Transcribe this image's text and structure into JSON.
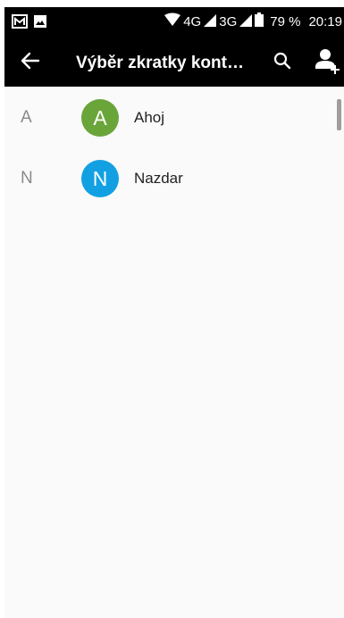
{
  "status_bar": {
    "left_icons": [
      "gallery-icon",
      "image-icon"
    ],
    "network1": "4G",
    "network2": "3G",
    "battery": "79 %",
    "time": "20:19"
  },
  "app_bar": {
    "title": "Výběr zkratky kont…",
    "icons": [
      "back-arrow-icon",
      "search-icon",
      "add-contact-icon"
    ]
  },
  "contacts": [
    {
      "section": "A",
      "initial": "A",
      "name": "Ahoj",
      "color": "#6aa53a"
    },
    {
      "section": "N",
      "initial": "N",
      "name": "Nazdar",
      "color": "#12a0e3"
    }
  ]
}
